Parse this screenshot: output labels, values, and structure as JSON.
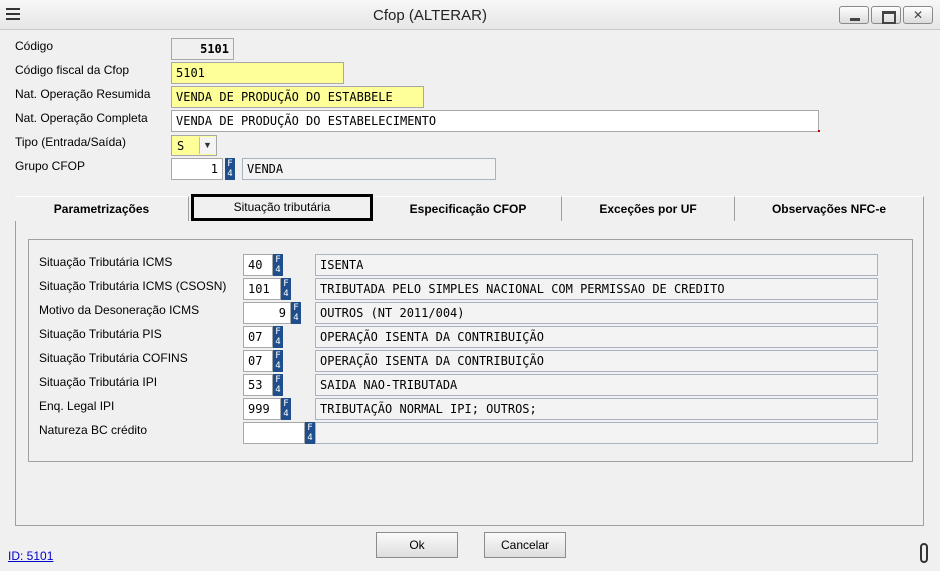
{
  "window": {
    "title": "Cfop (ALTERAR)"
  },
  "header": {
    "codigo_label": "Código",
    "codigo_value": "5101",
    "codigo_fiscal_label": "Código fiscal da Cfop",
    "codigo_fiscal_value": "5101",
    "nat_resumida_label": "Nat. Operação Resumida",
    "nat_resumida_value": "VENDA DE PRODUÇÃO DO ESTABBELE",
    "nat_completa_label": "Nat. Operação Completa",
    "nat_completa_value": "VENDA DE PRODUÇÃO DO ESTABELECIMENTO",
    "tipo_label": "Tipo (Entrada/Saída)",
    "tipo_value": "S",
    "grupo_label": "Grupo CFOP",
    "grupo_code": "1",
    "grupo_desc": "VENDA"
  },
  "tabs": [
    {
      "label": "Parametrizações"
    },
    {
      "label": "Situação tributária"
    },
    {
      "label": "Especificação CFOP"
    },
    {
      "label": "Exceções por UF"
    },
    {
      "label": "Observações NFC-e"
    }
  ],
  "rows": [
    {
      "label": "Situação Tributária ICMS",
      "code": "40",
      "desc": "ISENTA"
    },
    {
      "label": "Situação Tributária ICMS (CSOSN)",
      "code": "101",
      "desc": "TRIBUTADA PELO SIMPLES NACIONAL COM PERMISSAO DE CREDITO"
    },
    {
      "label": "Motivo da Desoneração ICMS",
      "code": "9",
      "desc": "OUTROS (NT 2011/004)"
    },
    {
      "label": "Situação Tributária PIS",
      "code": "07",
      "desc": "OPERAÇÃO ISENTA DA CONTRIBUIÇÃO"
    },
    {
      "label": "Situação Tributária COFINS",
      "code": "07",
      "desc": "OPERAÇÃO ISENTA DA CONTRIBUIÇÃO"
    },
    {
      "label": "Situação Tributária IPI",
      "code": "53",
      "desc": "SAIDA NAO-TRIBUTADA"
    },
    {
      "label": "Enq. Legal IPI",
      "code": "999",
      "desc": "TRIBUTAÇÃO NORMAL IPI; OUTROS;"
    },
    {
      "label": "Natureza BC crédito",
      "code": "",
      "desc": ""
    }
  ],
  "footer": {
    "ok_label": "Ok",
    "cancel_label": "Cancelar",
    "id_text": "ID: 5101"
  },
  "icons": {
    "f4": "F4"
  },
  "colors": {
    "required_field": "#ffff9a",
    "f4_button": "#1f4e8c"
  }
}
